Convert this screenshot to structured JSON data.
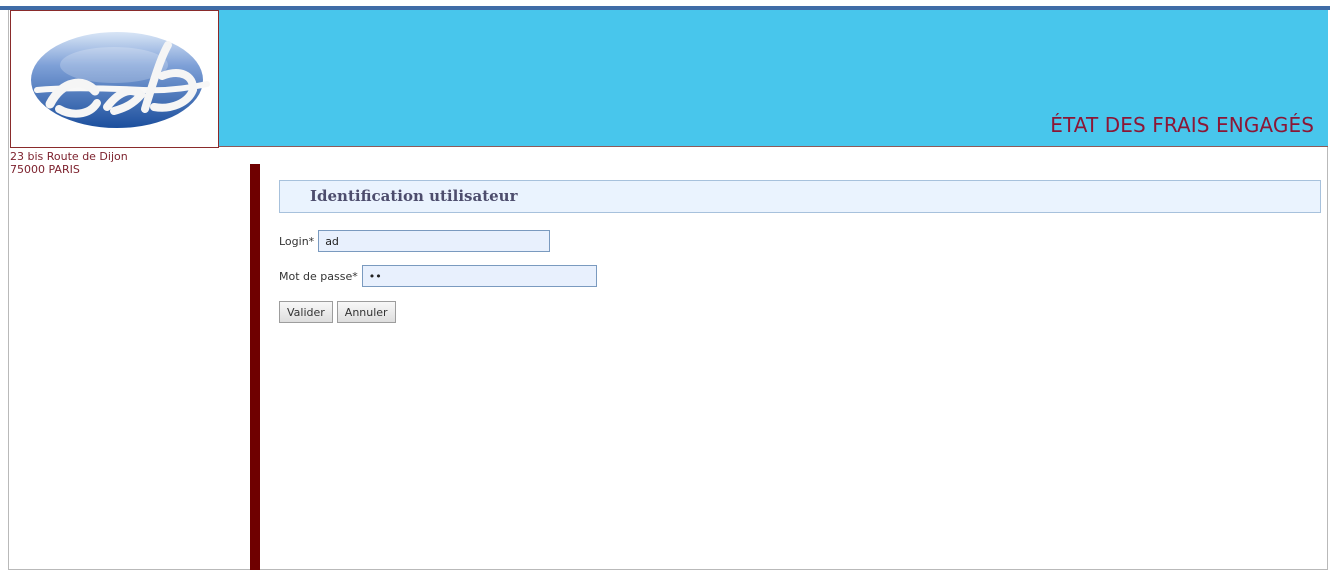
{
  "header": {
    "logo_text": "gsb",
    "title": "ÉTAT DES FRAIS ENGAGÉS"
  },
  "address": {
    "line1": "23 bis Route de Dijon",
    "line2": "75000 PARIS"
  },
  "login_section": {
    "title": "Identification utilisateur",
    "login_label": "Login*",
    "login_value": "ad",
    "password_label": "Mot de passe*",
    "password_value": "••",
    "submit_label": "Valider",
    "reset_label": "Annuler"
  },
  "colors": {
    "header_bg": "#48c6ec",
    "title_color": "#8b1736",
    "divider_color": "#6f0000",
    "section_bg": "#eaf3fe"
  }
}
